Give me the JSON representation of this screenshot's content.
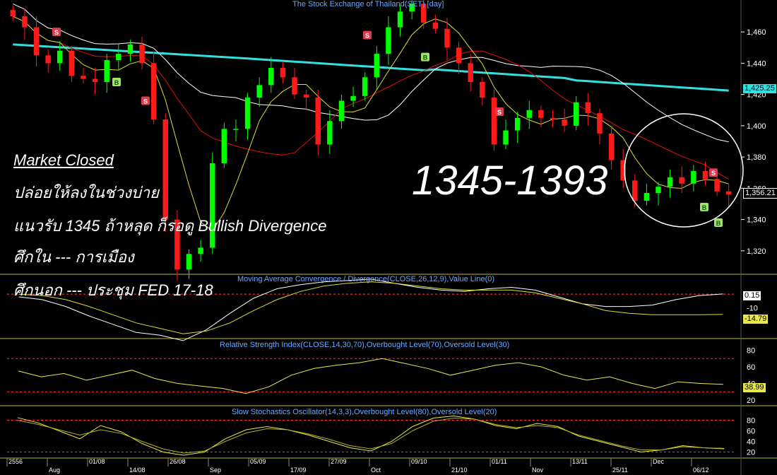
{
  "panels": {
    "price_title": "The Stock Exchange of Thailand(SET) [day]",
    "macd_title": "Moving Average Convergence / Divergence(CLOSE,26,12,9),Value Line(0)",
    "rsi_title": "Relative Strength Index(CLOSE,14,30,70),Overbought Level(70),Oversold Level(30)",
    "stoch_title": "Slow Stochastics Oscillator(14,3,3),Overbought Level(80),Oversold Level(20)"
  },
  "annotations": {
    "status": "Market Closed",
    "line1": "ปล่อยให้ลงในช่วงบ่าย",
    "line2": "แนวรับ 1345 ถ้าหลุด ก็รอดู Bullish Divergence",
    "line3": "ศึกใน --- การเมือง",
    "line4": "ศึกนอก --- ประชุม FED 17-18",
    "range": "1345-1393"
  },
  "price_tags": {
    "ma200": "1,425.25",
    "last": "1,356.21",
    "macd_a": "0.15",
    "macd_b": "-14.79",
    "rsi": "38.99"
  },
  "colors": {
    "up": "#00ff00",
    "down": "#ff1a1a",
    "ma_slow": "#33e0e0",
    "ma_mid": "#ffffff",
    "ma_red": "#dd1111",
    "ma_yellow": "#dddd33",
    "axis_text": "#ffffff",
    "title": "#6aa8ff",
    "overbought": "#ff3333",
    "zero_line": "#ff4444",
    "rsi_line": "#e8e84a",
    "panel_border": "#bbbb33"
  },
  "chart_data": [
    {
      "type": "candlestick",
      "title": "The Stock Exchange of Thailand(SET) [day]",
      "y_ticks": [
        1320,
        1340,
        1360,
        1380,
        1400,
        1420,
        1440,
        1460
      ],
      "ylim": [
        1305,
        1475
      ],
      "x_labels": [
        "2556",
        "Aug",
        "01/08",
        "14/08",
        "26/08",
        "Sep",
        "05/09",
        "17/09",
        "27/09",
        "Oct",
        "09/10",
        "21/10",
        "01/11",
        "Nov",
        "13/11",
        "25/11",
        "Dec",
        "06/12"
      ],
      "closes": [
        1470,
        1463,
        1445,
        1440,
        1448,
        1432,
        1430,
        1428,
        1442,
        1446,
        1452,
        1440,
        1404,
        1340,
        1308,
        1318,
        1322,
        1376,
        1398,
        1398,
        1418,
        1426,
        1437,
        1431,
        1420,
        1418,
        1388,
        1403,
        1416,
        1419,
        1431,
        1446,
        1463,
        1473,
        1478,
        1466,
        1462,
        1450,
        1440,
        1428,
        1418,
        1388,
        1397,
        1405,
        1410,
        1405,
        1404,
        1400,
        1415,
        1408,
        1395,
        1378,
        1365,
        1352,
        1357,
        1361,
        1367,
        1363,
        1371,
        1366,
        1358,
        1356
      ],
      "signals_S": [
        8,
        18,
        55,
        97,
        120,
        243,
        288
      ],
      "signals_B": [
        33,
        124,
        245,
        277,
        290
      ]
    },
    {
      "type": "line",
      "title": "Moving Average Convergence / Divergence(CLOSE,26,12,9),Value Line(0)",
      "y_ticks": [
        0,
        -10
      ],
      "ylim": [
        -32,
        12
      ],
      "macd": [
        -2,
        -4,
        -9,
        -16,
        -22,
        -28,
        -30,
        -34,
        -26,
        -14,
        -3,
        4,
        7,
        9,
        10,
        11,
        8,
        5,
        3,
        2,
        4,
        5,
        3,
        -2,
        -7,
        -9,
        -9,
        -8,
        -4,
        -1,
        0.15
      ],
      "signal": [
        0,
        -1,
        -4,
        -9,
        -15,
        -21,
        -25,
        -29,
        -27,
        -21,
        -12,
        -4,
        2,
        6,
        8,
        9,
        8,
        6,
        4,
        3,
        3,
        3,
        1,
        -3,
        -7,
        -12,
        -14,
        -15,
        -15,
        -15,
        -14.79
      ]
    },
    {
      "type": "line",
      "title": "Relative Strength Index(CLOSE,14,30,70),Overbought Level(70),Oversold Level(30)",
      "y_ticks": [
        20,
        40,
        60,
        80
      ],
      "ylim": [
        15,
        88
      ],
      "levels": [
        70,
        30
      ],
      "values": [
        55,
        48,
        52,
        44,
        50,
        56,
        46,
        40,
        37,
        34,
        28,
        36,
        50,
        58,
        62,
        65,
        70,
        64,
        58,
        50,
        56,
        62,
        65,
        60,
        50,
        44,
        48,
        40,
        34,
        42,
        40,
        38.99
      ]
    },
    {
      "type": "line",
      "title": "Slow Stochastics Oscillator(14,3,3),Overbought Level(80),Oversold Level(20)",
      "y_ticks": [
        20,
        40,
        60,
        80
      ],
      "ylim": [
        10,
        98
      ],
      "levels": [
        80,
        20
      ],
      "k": [
        85,
        75,
        60,
        45,
        70,
        58,
        36,
        20,
        14,
        20,
        45,
        62,
        68,
        62,
        52,
        40,
        28,
        22,
        40,
        68,
        84,
        88,
        82,
        70,
        64,
        74,
        68,
        50,
        40,
        30,
        20,
        24,
        32,
        28,
        26
      ],
      "d": [
        80,
        72,
        62,
        52,
        62,
        55,
        40,
        26,
        18,
        22,
        40,
        56,
        64,
        62,
        54,
        44,
        32,
        26,
        36,
        60,
        78,
        84,
        82,
        72,
        66,
        70,
        66,
        52,
        42,
        32,
        24,
        24,
        30,
        28,
        27
      ]
    }
  ]
}
